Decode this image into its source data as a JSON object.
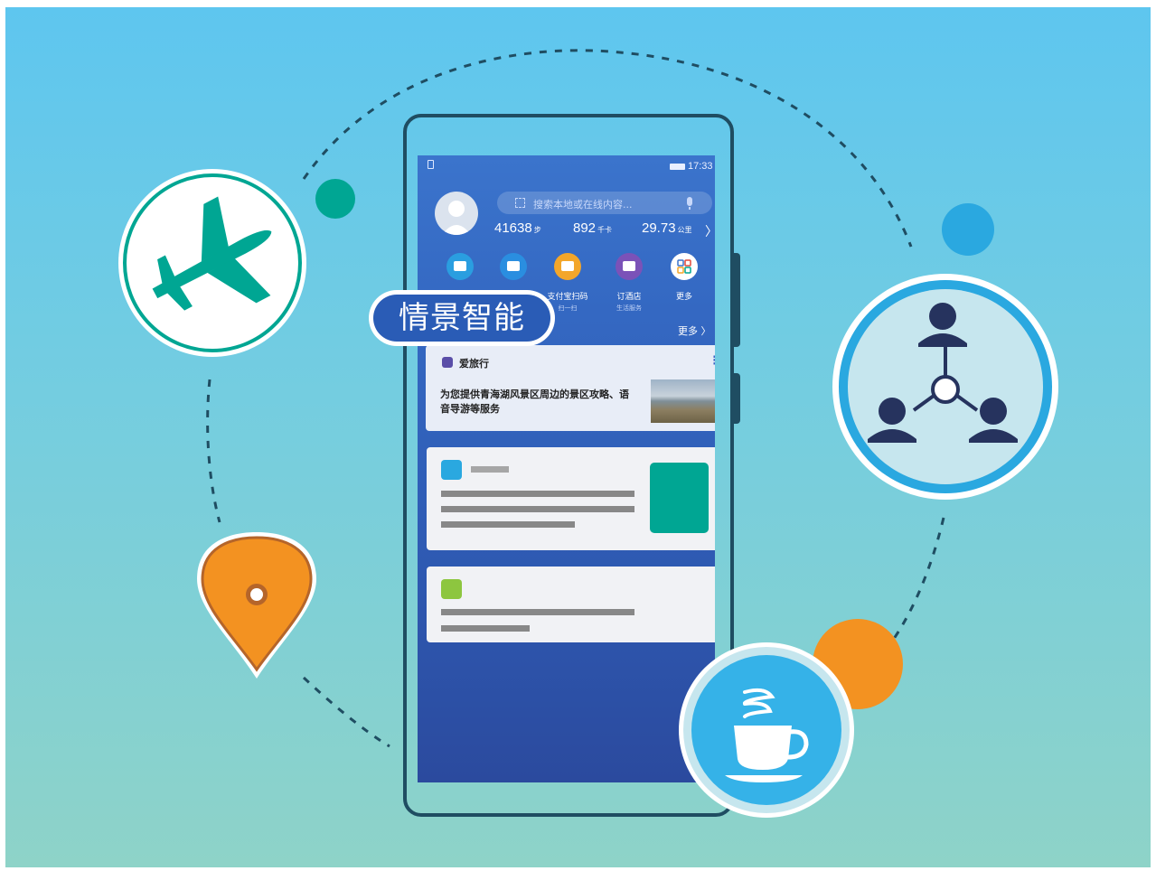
{
  "bubble_label": "情景智能",
  "status_bar": {
    "time": "17:33"
  },
  "search": {
    "placeholder": "搜索本地或在线内容..."
  },
  "stats": [
    {
      "value": "41638",
      "unit": "步"
    },
    {
      "value": "892",
      "unit": "千卡"
    },
    {
      "value": "29.73",
      "unit": "公里"
    }
  ],
  "apps": [
    {
      "label": "",
      "sub": "",
      "color": "#2a9ee0",
      "icon": "taxi-icon"
    },
    {
      "label": "",
      "sub": "",
      "color": "#2a8ee0",
      "icon": "bus-card-icon"
    },
    {
      "label": "支付宝扫码",
      "sub": "扫一扫",
      "color": "#f3a62a",
      "icon": "alipay-scan-icon"
    },
    {
      "label": "订酒店",
      "sub": "生活服务",
      "color": "#7b52b8",
      "icon": "hotel-icon"
    },
    {
      "label": "更多",
      "sub": "",
      "color": "#ffffff",
      "icon": "more-apps-icon"
    }
  ],
  "more_link": "更多 〉",
  "travel_card": {
    "title": "爱旅行",
    "description": "为您提供青海湖风景区周边的景区攻略、语音导游等服务"
  },
  "colors": {
    "travel_green": "#00a693",
    "network_blue": "#2aa8e0",
    "location_orange": "#f39221",
    "coffee_blue": "#35b2e8",
    "template_green": "#8dc63f",
    "navy": "#26335e"
  }
}
